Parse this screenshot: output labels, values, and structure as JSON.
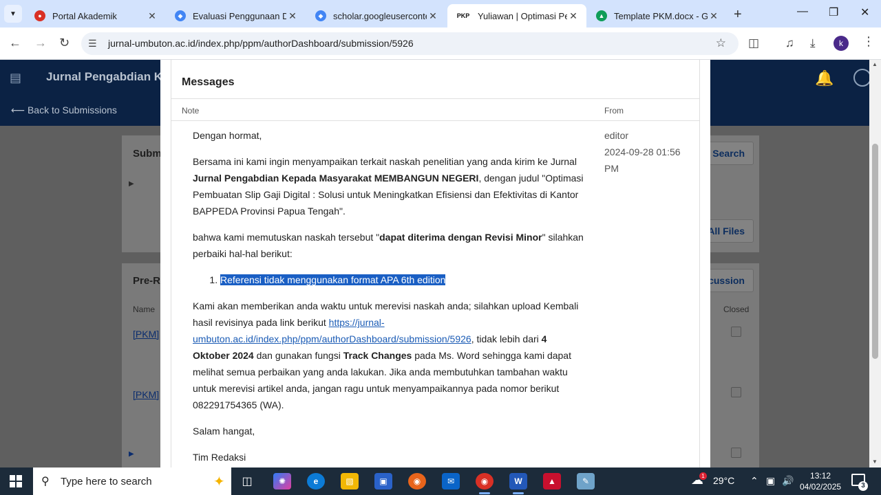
{
  "browser": {
    "tabs": [
      {
        "label": "Portal Akademik",
        "favicon": "portal-icon",
        "color": "#d93025"
      },
      {
        "label": "Evaluasi Penggunaan Dar",
        "favicon": "scholar-icon",
        "color": "#4285f4"
      },
      {
        "label": "scholar.googleuserconte",
        "favicon": "scholar-icon",
        "color": "#4285f4"
      },
      {
        "label": "Yuliawan | Optimasi Pem",
        "favicon": "pkp-icon",
        "favicon_text": "PKP",
        "color": "#ffffff"
      },
      {
        "label": "Template PKM.docx - Go",
        "favicon": "drive-icon",
        "color": "#0f9d58"
      }
    ],
    "url": "jurnal-umbuton.ac.id/index.php/ppm/authorDashboard/submission/5926",
    "profile_initial": "k"
  },
  "site": {
    "journal_name": "Jurnal Pengabdian Ke",
    "back_link": "⟵ Back to Submissions"
  },
  "background": {
    "card1_title": "Subm",
    "search_btn": "Search",
    "all_files_btn": "All Files",
    "card2_title": "Pre-R",
    "discussion_btn": "scussion",
    "col_name": "Name",
    "col_closed": "Closed",
    "row1": "[PKM]",
    "row2": "[PKM]"
  },
  "modal": {
    "title": "Messages",
    "col_note": "Note",
    "col_from": "From",
    "from_name": "editor",
    "from_date": "2024-09-28 01:56 PM",
    "greeting": "Dengan hormat,",
    "p1_start": "Bersama ini kami ingin menyampaikan terkait naskah penelitian yang anda kirim ke Jurnal ",
    "p1_journal": "Jurnal Pengabdian Kepada Masyarakat MEMBANGUN NEGERI",
    "p1_end": ", dengan judul \"Optimasi Pembuatan Slip Gaji Digital : Solusi untuk Meningkatkan Efisiensi dan Efektivitas di Kantor BAPPEDA Provinsi Papua Tengah\".",
    "p2_start": "bahwa kami memutuskan naskah tersebut \"",
    "p2_decision": "dapat diterima dengan Revisi Minor",
    "p2_end": "\" silahkan  perbaiki hal-hal berikut:",
    "list_item_1": "Referensi tidak menggunakan format APA 6th edition",
    "p3_start": "Kami akan memberikan anda waktu untuk merevisi naskah anda; silahkan upload Kembali hasil revisinya pada link berikut ",
    "p3_link": "https://jurnal-umbuton.ac.id/index.php/ppm/authorDashboard/submission/5926",
    "p3_mid": ", tidak lebih dari ",
    "p3_deadline": "4 Oktober 2024",
    "p3_mid2": " dan gunakan fungsi ",
    "p3_feature": "Track Changes",
    "p3_end": " pada Ms. Word sehingga kami dapat melihat semua perbaikan yang anda lakukan. Jika anda membutuhkan tambahan waktu untuk merevisi artikel anda, jangan ragu untuk menyampaikannya pada nomor berikut 082291754365 (WA).",
    "closing": "Salam hangat,",
    "signature": "Tim Redaksi"
  },
  "taskbar": {
    "search_placeholder": "Type here to search",
    "temperature": "29°C",
    "time": "13:12",
    "date": "04/02/2025",
    "notification_count": "3",
    "weather_alert": "1"
  }
}
